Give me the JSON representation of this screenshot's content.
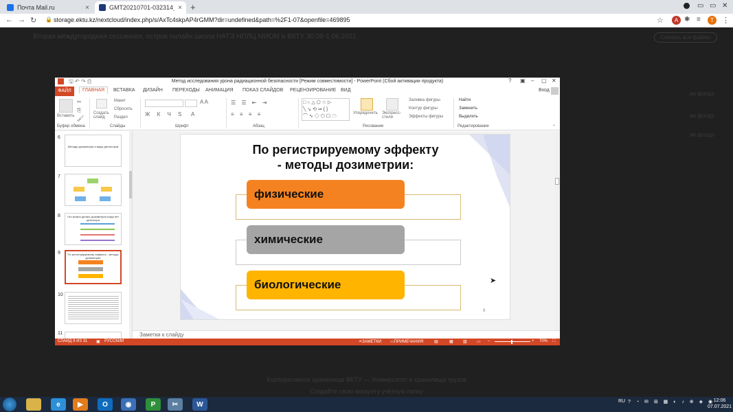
{
  "browser": {
    "tabs": [
      {
        "title": "Почта Mail.ru",
        "active": false
      },
      {
        "title": "GMT20210701-032314_Rec",
        "active": true
      }
    ],
    "url": "storage.ektu.kz/nextcloud/index.php/s/AxTc4skpAP4rGMM?dir=undefined&path=%2F1-07&openfile=469895",
    "avatar_letter": "T"
  },
  "viewer": {
    "ghost_title": "Вторая междугородная сессиноая, остров онлайн школа НАТЭ НПЛЦ МИОМ и ВКТУ 30.06-1.06.2021",
    "ghost_button": "Скачать все файлы",
    "ghost_side": [
      "мк фолдэ",
      "мк фолдэ",
      "мк фолдэ"
    ],
    "ghost_bottom1": "Корпоративное хранилище ВКТУ — Университет в хранилище грузов",
    "ghost_bottom2": "Создайте свою аккаунту учётную папку"
  },
  "ppt": {
    "window_title": "Метод исследования урона радиационной безопасности [Режим совместимости] - PowerPoint (Сбой активации продукта)",
    "signin": "Вход",
    "ribbon_tabs": [
      "ФАЙЛ",
      "ГЛАВНАЯ",
      "ВСТАВКА",
      "ДИЗАЙН",
      "ПЕРЕХОДЫ",
      "АНИМАЦИЯ",
      "ПОКАЗ СЛАЙДОВ",
      "РЕЦЕНЗИРОВАНИЕ",
      "ВИД"
    ],
    "ribbon_groups": [
      "Буфер обмена",
      "Слайды",
      "Шрифт",
      "Абзац",
      "Рисование",
      "Редактирование"
    ],
    "ribbon_buttons": {
      "paste": "Вставить",
      "create_slide": "Создать слайд",
      "layout": "Макет",
      "reset": "Сбросить",
      "section": "Раздел",
      "arrange": "Упорядочить",
      "express_styles": "Экспресс-стили",
      "shape_fill": "Заливка фигуры",
      "shape_outline": "Контур фигуры",
      "shape_effects": "Эффекты фигуры",
      "find": "Найти",
      "replace": "Заменить",
      "select": "Выделить"
    },
    "thumbnails": [
      {
        "num": "6",
        "text": "Методы дозиметрии и виды детекторов"
      },
      {
        "num": "7",
        "text": ""
      },
      {
        "num": "8",
        "text": "Что можно делать дозиметрия когда нет детектора"
      },
      {
        "num": "9",
        "text": "По регистрируемому эффекту - методы дозиметрии"
      },
      {
        "num": "10",
        "text": ""
      },
      {
        "num": "11",
        "text": ""
      }
    ],
    "slide": {
      "title_line1": "По регистрируемому эффекту",
      "title_line2": "- методы дозиметрии:",
      "items": [
        {
          "label": "физические",
          "color": "#f58220"
        },
        {
          "label": "химические",
          "color": "#a5a5a5"
        },
        {
          "label": "биологические",
          "color": "#ffb400"
        }
      ],
      "number": "9"
    },
    "notes_placeholder": "Заметки к слайду",
    "status": {
      "slide": "СЛАЙД 9 ИЗ 31",
      "language": "РУССКИЙ",
      "notes": "ЗАМЕТКИ",
      "comments": "ПРИМЕЧАНИЯ",
      "zoom": "70%"
    }
  },
  "taskbar": {
    "lang": "RU",
    "time": "12:06",
    "date": "07.07.2021"
  }
}
